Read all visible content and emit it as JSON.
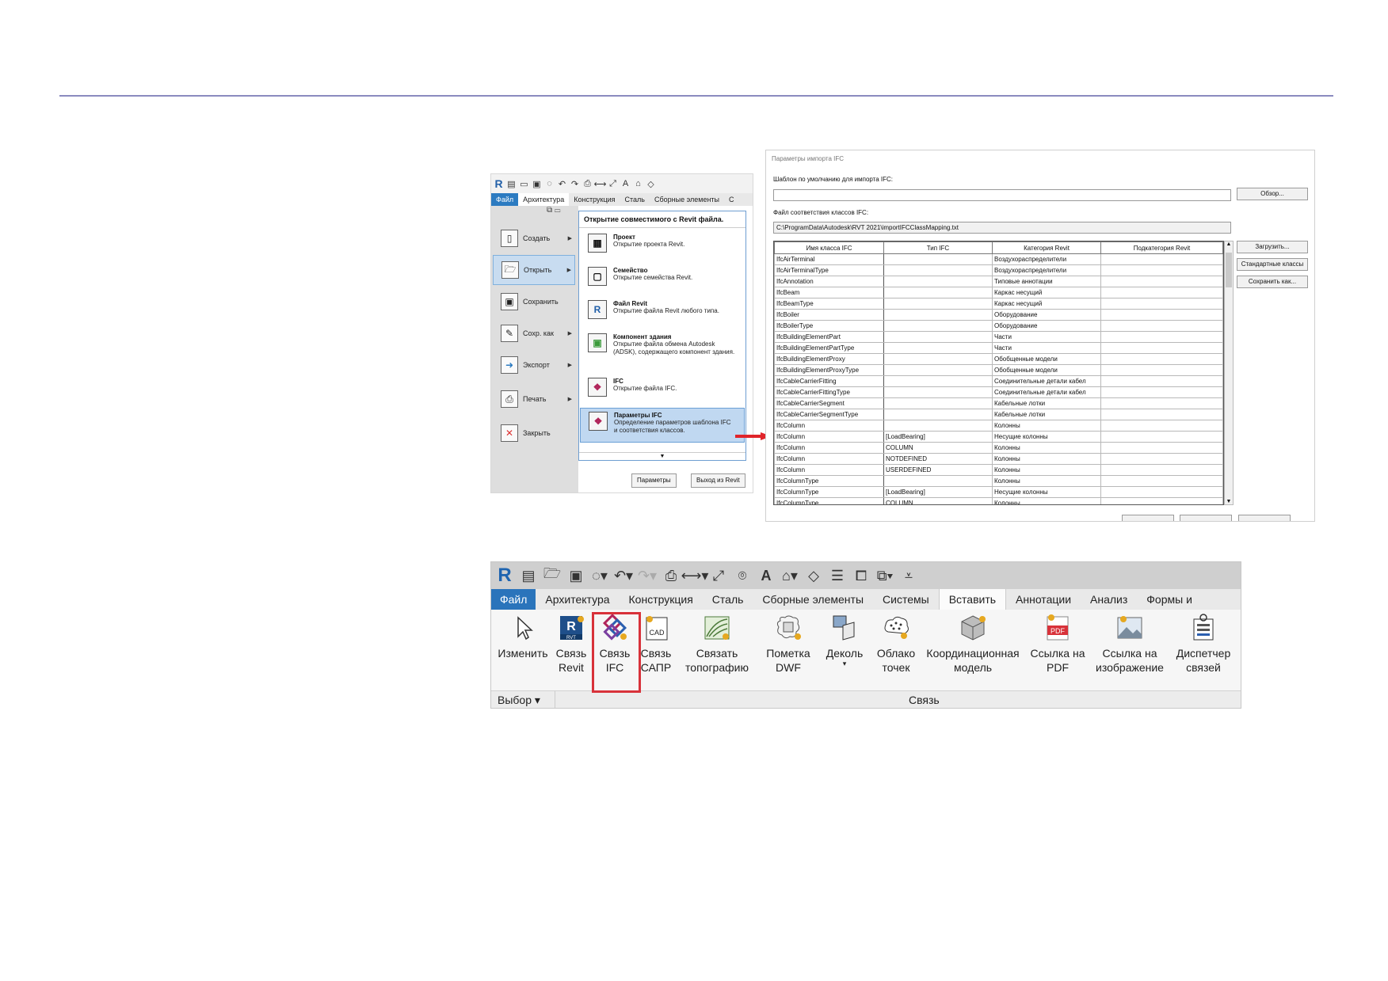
{
  "screen1": {
    "qat_logo": "R",
    "tabs": [
      "Файл",
      "Архитектура",
      "Конструкция",
      "Сталь",
      "Сборные элементы",
      "С"
    ],
    "left_menu": [
      {
        "label": "Создать",
        "icon": "new-file-icon"
      },
      {
        "label": "Открыть",
        "icon": "open-folder-icon",
        "selected": true
      },
      {
        "label": "Сохранить",
        "icon": "save-icon"
      },
      {
        "label": "Сохр. как",
        "icon": "save-as-icon"
      },
      {
        "label": "Экспорт",
        "icon": "export-icon"
      },
      {
        "label": "Печать",
        "icon": "print-icon"
      },
      {
        "label": "Закрыть",
        "icon": "close-file-icon"
      }
    ],
    "submenu_header": "Открытие совместимого с Revit файла.",
    "submenu": [
      {
        "title": "Проект",
        "desc": "Открытие проекта Revit.",
        "glyph": "▦"
      },
      {
        "title": "Семейство",
        "desc": "Открытие семейства Revit.",
        "glyph": "▢"
      },
      {
        "title": "Файл Revit",
        "desc": "Открытие файла Revit любого типа.",
        "glyph": "R"
      },
      {
        "title": "Компонент здания",
        "desc": "Открытие файла обмена Autodesk (ADSK), содержащего компонент здания.",
        "glyph": "▣"
      },
      {
        "title": "IFC",
        "desc": "Открытие файла IFC.",
        "glyph": "❖"
      },
      {
        "title": "Параметры IFC",
        "desc": "Определение параметров шаблона IFC и соответствия классов.",
        "glyph": "❖",
        "selected": true
      }
    ],
    "btn_params": "Параметры",
    "btn_exit": "Выход из Revit"
  },
  "screen2": {
    "title": "Параметры импорта IFC",
    "template_label": "Шаблон по умолчанию для импорта IFC:",
    "template_value": "",
    "browse": "Обзор...",
    "mapping_label": "Файл соответствия классов IFC:",
    "mapping_path": "C:\\ProgramData\\Autodesk\\RVT 2021\\importIFCClassMapping.txt",
    "columns": [
      "Имя класса IFC",
      "Тип IFC",
      "Категория Revit",
      "Подкатегория Revit"
    ],
    "rows": [
      [
        "IfcAirTerminal",
        "",
        "Воздухораспределители",
        ""
      ],
      [
        "IfcAirTerminalType",
        "",
        "Воздухораспределители",
        ""
      ],
      [
        "IfcAnnotation",
        "",
        "Типовые аннотации",
        ""
      ],
      [
        "IfcBeam",
        "",
        "Каркас несущий",
        ""
      ],
      [
        "IfcBeamType",
        "",
        "Каркас несущий",
        ""
      ],
      [
        "IfcBoiler",
        "",
        "Оборудование",
        ""
      ],
      [
        "IfcBoilerType",
        "",
        "Оборудование",
        ""
      ],
      [
        "IfcBuildingElementPart",
        "",
        "Части",
        ""
      ],
      [
        "IfcBuildingElementPartType",
        "",
        "Части",
        ""
      ],
      [
        "IfcBuildingElementProxy",
        "",
        "Обобщенные модели",
        ""
      ],
      [
        "IfcBuildingElementProxyType",
        "",
        "Обобщенные модели",
        ""
      ],
      [
        "IfcCableCarrierFitting",
        "",
        "Соединительные детали кабел",
        ""
      ],
      [
        "IfcCableCarrierFittingType",
        "",
        "Соединительные детали кабел",
        ""
      ],
      [
        "IfcCableCarrierSegment",
        "",
        "Кабельные лотки",
        ""
      ],
      [
        "IfcCableCarrierSegmentType",
        "",
        "Кабельные лотки",
        ""
      ],
      [
        "IfcColumn",
        "",
        "Колонны",
        ""
      ],
      [
        "IfcColumn",
        "[LoadBearing]",
        "Несущие колонны",
        ""
      ],
      [
        "IfcColumn",
        "COLUMN",
        "Колонны",
        ""
      ],
      [
        "IfcColumn",
        "NOTDEFINED",
        "Колонны",
        ""
      ],
      [
        "IfcColumn",
        "USERDEFINED",
        "Колонны",
        ""
      ],
      [
        "IfcColumnType",
        "",
        "Колонны",
        ""
      ],
      [
        "IfcColumnType",
        "[LoadBearing]",
        "Несущие колонны",
        ""
      ],
      [
        "IfcColumnType",
        "COLUMN",
        "Колонны",
        ""
      ]
    ],
    "btn_load": "Загрузить...",
    "btn_standard": "Стандартные классы",
    "btn_save_as": "Сохранить как..."
  },
  "screen3": {
    "logo": "R",
    "tabs": [
      "Файл",
      "Архитектура",
      "Конструкция",
      "Сталь",
      "Сборные элементы",
      "Системы",
      "Вставить",
      "Аннотации",
      "Анализ",
      "Формы и"
    ],
    "active_tab": "Вставить",
    "tools": [
      {
        "label": "Изменить",
        "icon": "cursor-arrow-icon"
      },
      {
        "label": "Связь\nRevit",
        "icon": "link-revit-icon"
      },
      {
        "label": "Связь\nIFC",
        "icon": "link-ifc-icon"
      },
      {
        "label": "Связь\nСАПР",
        "icon": "link-cad-icon"
      },
      {
        "label": "Связать\nтопографию",
        "icon": "link-topography-icon"
      },
      {
        "label": "Пометка\nDWF",
        "icon": "dwf-markup-icon"
      },
      {
        "label": "Деколь",
        "icon": "decal-icon"
      },
      {
        "label": "Облако\nточек",
        "icon": "point-cloud-icon"
      },
      {
        "label": "Координационная\nмодель",
        "icon": "coordination-model-icon"
      },
      {
        "label": "Ссылка на\nPDF",
        "icon": "pdf-link-icon"
      },
      {
        "label": "Ссылка на\nизображение",
        "icon": "image-link-icon"
      },
      {
        "label": "Диспетчер\nсвязей",
        "icon": "link-manager-icon"
      }
    ],
    "panel_select": "Выбор",
    "panel_link": "Связь",
    "pdf_text": "PDF",
    "cad_text": "CAD",
    "rvt_text": "RVT"
  },
  "colors": {
    "file_tab": "#2a74bb",
    "highlight_red": "#d8323a",
    "arrow_red": "#e0242a",
    "selection_blue": "#c0d8f1"
  }
}
